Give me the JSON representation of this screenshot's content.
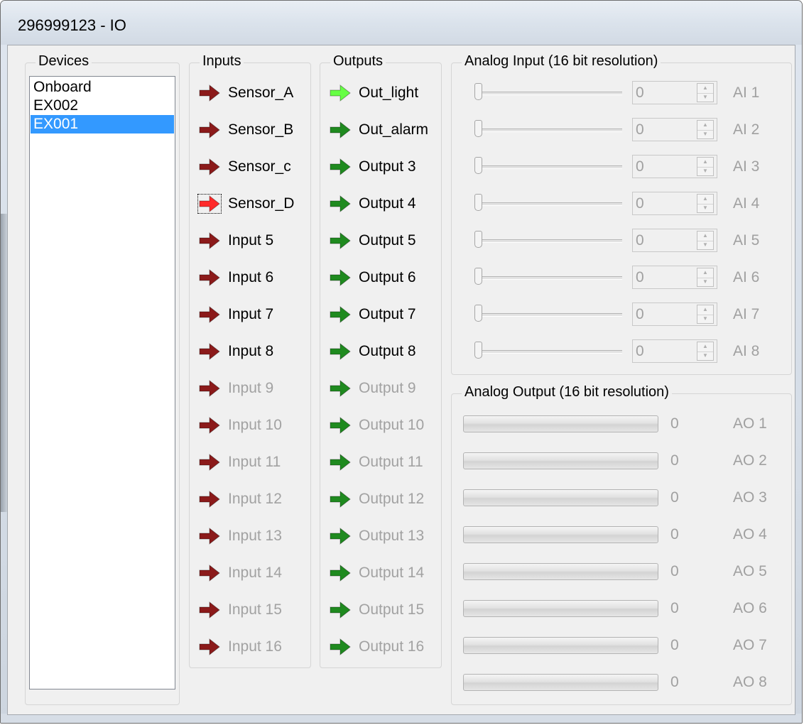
{
  "window": {
    "title": "296999123 - IO"
  },
  "devices": {
    "legend": "Devices",
    "items": [
      {
        "label": "Onboard",
        "selected": false
      },
      {
        "label": "EX002",
        "selected": false
      },
      {
        "label": "EX001",
        "selected": true
      }
    ]
  },
  "inputs": {
    "legend": "Inputs",
    "items": [
      {
        "label": "Sensor_A",
        "enabled": true,
        "active": false
      },
      {
        "label": "Sensor_B",
        "enabled": true,
        "active": false
      },
      {
        "label": "Sensor_c",
        "enabled": true,
        "active": false
      },
      {
        "label": "Sensor_D",
        "enabled": true,
        "active": true
      },
      {
        "label": "Input 5",
        "enabled": true,
        "active": false
      },
      {
        "label": "Input 6",
        "enabled": true,
        "active": false
      },
      {
        "label": "Input 7",
        "enabled": true,
        "active": false
      },
      {
        "label": "Input 8",
        "enabled": true,
        "active": false
      },
      {
        "label": "Input 9",
        "enabled": false,
        "active": false
      },
      {
        "label": "Input 10",
        "enabled": false,
        "active": false
      },
      {
        "label": "Input 11",
        "enabled": false,
        "active": false
      },
      {
        "label": "Input 12",
        "enabled": false,
        "active": false
      },
      {
        "label": "Input 13",
        "enabled": false,
        "active": false
      },
      {
        "label": "Input 14",
        "enabled": false,
        "active": false
      },
      {
        "label": "Input 15",
        "enabled": false,
        "active": false
      },
      {
        "label": "Input 16",
        "enabled": false,
        "active": false
      }
    ]
  },
  "outputs": {
    "legend": "Outputs",
    "items": [
      {
        "label": "Out_light",
        "enabled": true,
        "active": true
      },
      {
        "label": "Out_alarm",
        "enabled": true,
        "active": false
      },
      {
        "label": "Output 3",
        "enabled": true,
        "active": false
      },
      {
        "label": "Output 4",
        "enabled": true,
        "active": false
      },
      {
        "label": "Output 5",
        "enabled": true,
        "active": false
      },
      {
        "label": "Output 6",
        "enabled": true,
        "active": false
      },
      {
        "label": "Output 7",
        "enabled": true,
        "active": false
      },
      {
        "label": "Output 8",
        "enabled": true,
        "active": false
      },
      {
        "label": "Output 9",
        "enabled": false,
        "active": false
      },
      {
        "label": "Output 10",
        "enabled": false,
        "active": false
      },
      {
        "label": "Output 11",
        "enabled": false,
        "active": false
      },
      {
        "label": "Output 12",
        "enabled": false,
        "active": false
      },
      {
        "label": "Output 13",
        "enabled": false,
        "active": false
      },
      {
        "label": "Output 14",
        "enabled": false,
        "active": false
      },
      {
        "label": "Output 15",
        "enabled": false,
        "active": false
      },
      {
        "label": "Output 16",
        "enabled": false,
        "active": false
      }
    ]
  },
  "analog_input": {
    "legend": "Analog Input (16 bit resolution)",
    "items": [
      {
        "label": "AI 1",
        "value": "0",
        "slider_level": 0
      },
      {
        "label": "AI 2",
        "value": "0",
        "slider_level": 0
      },
      {
        "label": "AI 3",
        "value": "0",
        "slider_level": 0
      },
      {
        "label": "AI 4",
        "value": "0",
        "slider_level": 0
      },
      {
        "label": "AI 5",
        "value": "0",
        "slider_level": 0
      },
      {
        "label": "AI 6",
        "value": "0",
        "slider_level": 0
      },
      {
        "label": "AI 7",
        "value": "0",
        "slider_level": 0
      },
      {
        "label": "AI 8",
        "value": "0",
        "slider_level": 0
      }
    ]
  },
  "analog_output": {
    "legend": "Analog Output (16 bit resolution)",
    "items": [
      {
        "label": "AO 1",
        "value": "0",
        "level": 0
      },
      {
        "label": "AO 2",
        "value": "0",
        "level": 0
      },
      {
        "label": "AO 3",
        "value": "0",
        "level": 0
      },
      {
        "label": "AO 4",
        "value": "0",
        "level": 0
      },
      {
        "label": "AO 5",
        "value": "0",
        "level": 0
      },
      {
        "label": "AO 6",
        "value": "0",
        "level": 0
      },
      {
        "label": "AO 7",
        "value": "0",
        "level": 0
      },
      {
        "label": "AO 8",
        "value": "0",
        "level": 0
      }
    ]
  },
  "colors": {
    "input_arrow": "#8b1a1a",
    "input_arrow_active": "#ff2a2a",
    "output_arrow": "#1f8a1f",
    "output_arrow_active": "#66ff44",
    "selection": "#3399ff",
    "disabled_text": "#a2a2a2"
  },
  "icons": {
    "input": "arrow-right-icon",
    "output": "arrow-right-icon"
  }
}
